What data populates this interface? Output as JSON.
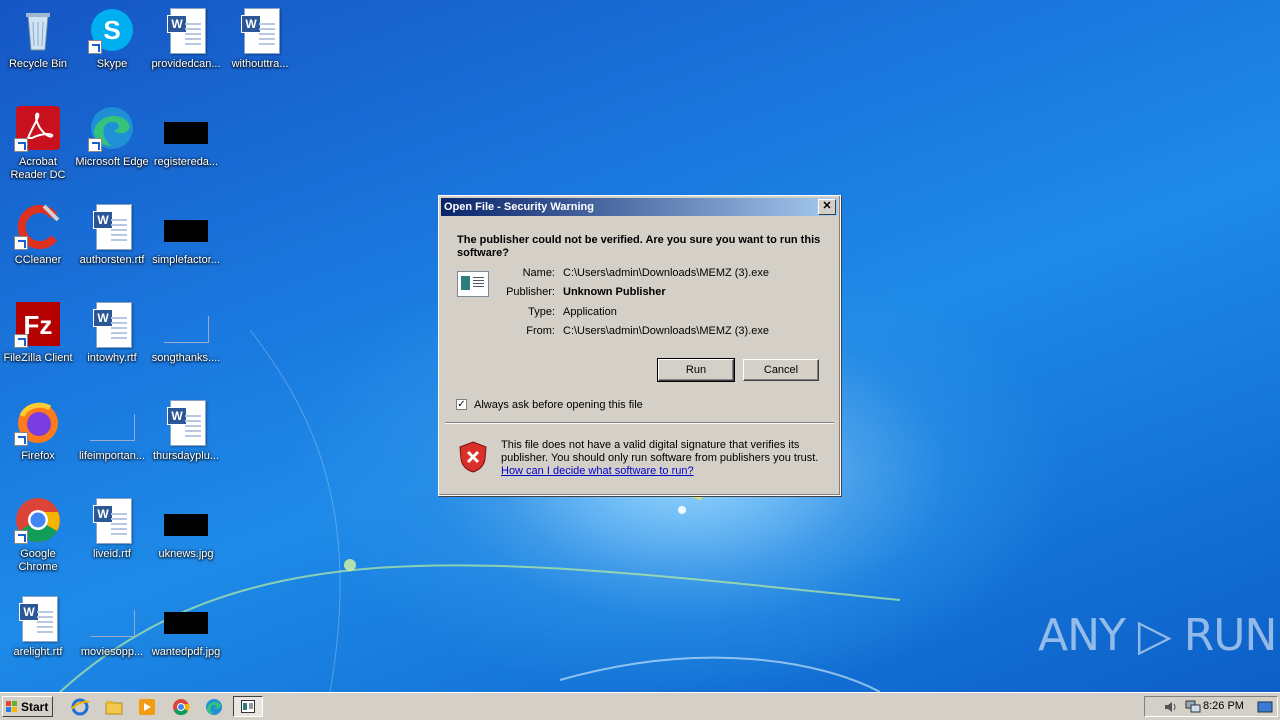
{
  "desktop": {
    "icons": [
      {
        "label": "Recycle Bin",
        "type": "recycle"
      },
      {
        "label": "Skype",
        "type": "skype"
      },
      {
        "label": "providedcan...",
        "type": "word"
      },
      {
        "label": "withouttra...",
        "type": "word"
      },
      {
        "label": "Acrobat Reader DC",
        "type": "acrobat"
      },
      {
        "label": "Microsoft Edge",
        "type": "edge"
      },
      {
        "label": "registereda...",
        "type": "black"
      },
      {
        "label": "CCleaner",
        "type": "ccleaner"
      },
      {
        "label": "authorsten.rtf",
        "type": "word"
      },
      {
        "label": "simplefactor...",
        "type": "black"
      },
      {
        "label": "FileZilla Client",
        "type": "filezilla"
      },
      {
        "label": "intowhy.rtf",
        "type": "word"
      },
      {
        "label": "songthanks....",
        "type": "blank"
      },
      {
        "label": "Firefox",
        "type": "firefox"
      },
      {
        "label": "lifeimportan...",
        "type": "blank"
      },
      {
        "label": "thursdayplu...",
        "type": "word"
      },
      {
        "label": "Google Chrome",
        "type": "chrome"
      },
      {
        "label": "liveid.rtf",
        "type": "word"
      },
      {
        "label": "uknews.jpg",
        "type": "black"
      },
      {
        "label": "arelight.rtf",
        "type": "word"
      },
      {
        "label": "moviesopp...",
        "type": "blank"
      },
      {
        "label": "wantedpdf.jpg",
        "type": "black"
      }
    ]
  },
  "dialog": {
    "title": "Open File - Security Warning",
    "close_label": "✕",
    "question": "The publisher could not be verified.  Are you sure you want to run this software?",
    "fields": {
      "name_label": "Name:",
      "name_value": "C:\\Users\\admin\\Downloads\\MEMZ (3).exe",
      "publisher_label": "Publisher:",
      "publisher_value": "Unknown Publisher",
      "type_label": "Type:",
      "type_value": "Application",
      "from_label": "From:",
      "from_value": "C:\\Users\\admin\\Downloads\\MEMZ (3).exe"
    },
    "run_label": "Run",
    "cancel_label": "Cancel",
    "checkbox_label": "Always ask before opening this file",
    "checkbox_checked": true,
    "checkbox_mark": "✓",
    "warning_text": "This file does not have a valid digital signature that verifies its publisher.  You should only run software from publishers you trust.",
    "warning_link": "How can I decide what software to run?"
  },
  "watermark": {
    "text": "ANY ▷ RUN"
  },
  "taskbar": {
    "start_label": "Start",
    "clock": "8:26 PM",
    "quick_launch": [
      "internet-explorer-icon",
      "file-explorer-icon",
      "media-player-icon",
      "chrome-icon",
      "edge-icon",
      "security-warning-task-icon"
    ]
  },
  "colors": {
    "desktop_blue": "#1a78de",
    "dialog_face": "#d4d0c8",
    "titlebar_start": "#0a246a",
    "titlebar_end": "#a6caf0",
    "link": "#0000cc"
  }
}
